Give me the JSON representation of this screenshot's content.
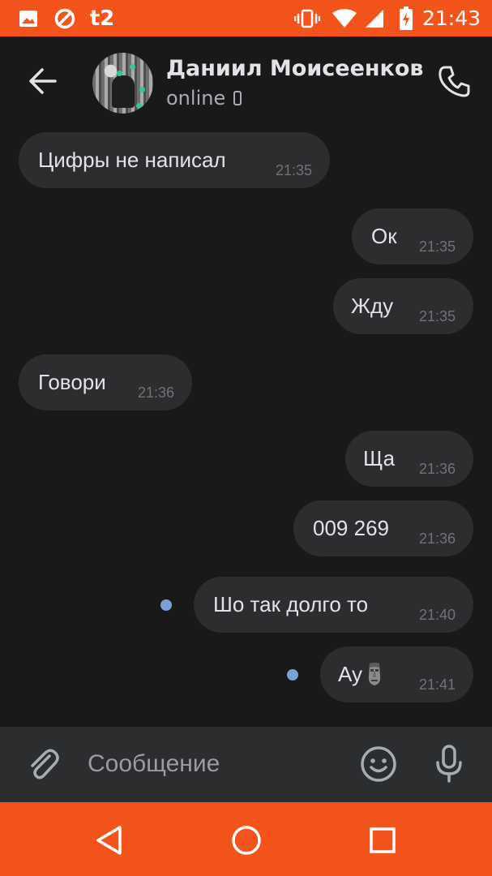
{
  "status_bar": {
    "carrier": "t2",
    "time": "21:43",
    "icons": [
      "image-icon",
      "blocked-icon",
      "carrier-logo",
      "vibrate-icon",
      "wifi-icon",
      "signal-icon",
      "battery-charging-icon"
    ]
  },
  "header": {
    "contact_name": "Даниил Моисеенков",
    "status": "online",
    "icons": [
      "back-arrow-icon",
      "avatar",
      "mobile-device-icon",
      "phone-icon"
    ]
  },
  "messages": [
    {
      "side": "in",
      "text": "Цифры не написал",
      "time": "21:35",
      "unread": false
    },
    {
      "side": "out",
      "text": "Ок",
      "time": "21:35",
      "unread": false
    },
    {
      "side": "out",
      "text": "Жду",
      "time": "21:35",
      "unread": false
    },
    {
      "side": "in",
      "text": "Говори",
      "time": "21:36",
      "unread": false
    },
    {
      "side": "out",
      "text": "Ща",
      "time": "21:36",
      "unread": false
    },
    {
      "side": "out",
      "text": "009 269",
      "time": "21:36",
      "unread": false
    },
    {
      "side": "out",
      "text": "Шо так долго то",
      "time": "21:40",
      "unread": true
    },
    {
      "side": "out",
      "text": "Ау",
      "emoji": "moai",
      "time": "21:41",
      "unread": true
    }
  ],
  "composer": {
    "placeholder": "Сообщение",
    "icons": [
      "attach-icon",
      "emoji-icon",
      "microphone-icon"
    ]
  },
  "nav_bar": {
    "icons": [
      "back-triangle-icon",
      "home-circle-icon",
      "recents-square-icon"
    ]
  },
  "colors": {
    "accent": "#f2541b",
    "background": "#19191a",
    "bubble": "#2c2d2e",
    "unread_dot": "#7aa0d4"
  }
}
